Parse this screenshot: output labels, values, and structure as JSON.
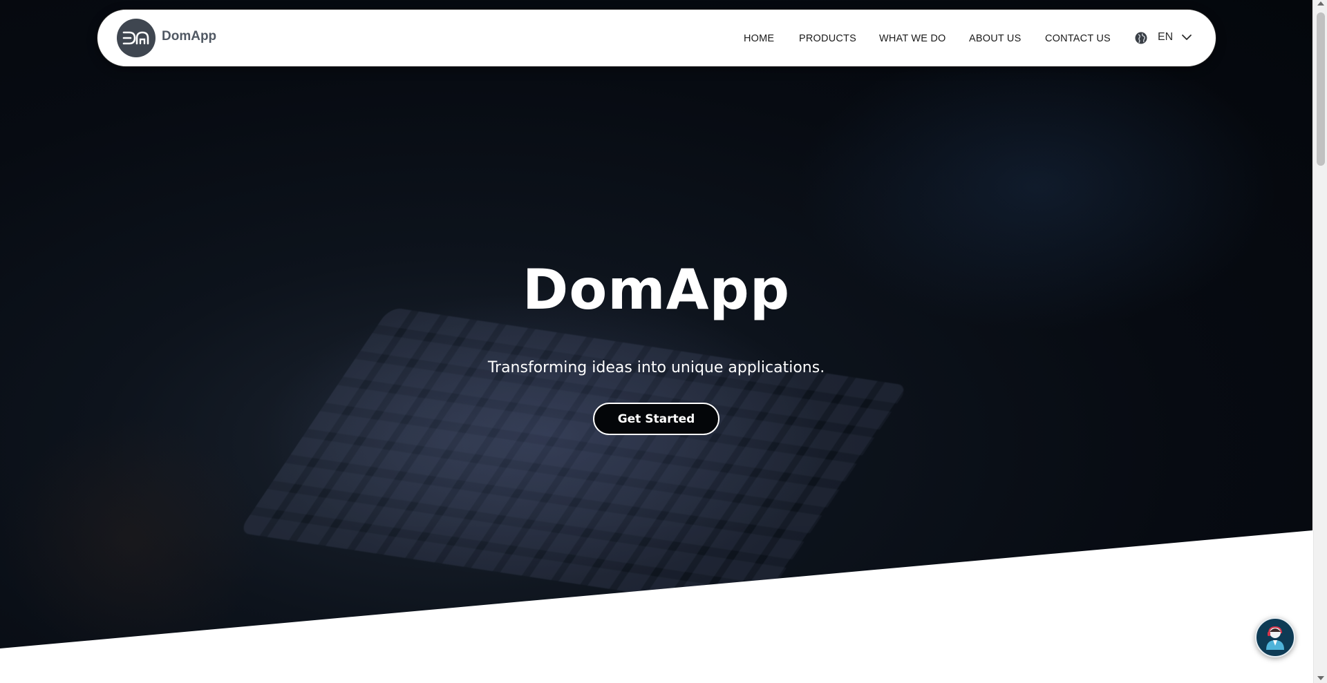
{
  "brand": {
    "name": "DomApp",
    "logo_icon": "da-monogram-icon"
  },
  "nav": {
    "items": [
      {
        "label": "HOME"
      },
      {
        "label": "PRODUCTS"
      },
      {
        "label": "WHAT WE DO"
      },
      {
        "label": "ABOUT US"
      },
      {
        "label": "CONTACT US"
      }
    ],
    "language": {
      "selected": "EN",
      "icon": "globe-icon"
    }
  },
  "hero": {
    "title": "DomApp",
    "subtitle": "Transforming ideas into unique applications.",
    "cta_label": "Get Started"
  },
  "chat_widget": {
    "icon": "support-agent-icon"
  },
  "colors": {
    "nav_bg": "#ffffff",
    "hero_bg": "#070b12",
    "logo_bg": "#3f4650",
    "chat_bg": "#0e3b55",
    "text_light": "#ffffff"
  }
}
